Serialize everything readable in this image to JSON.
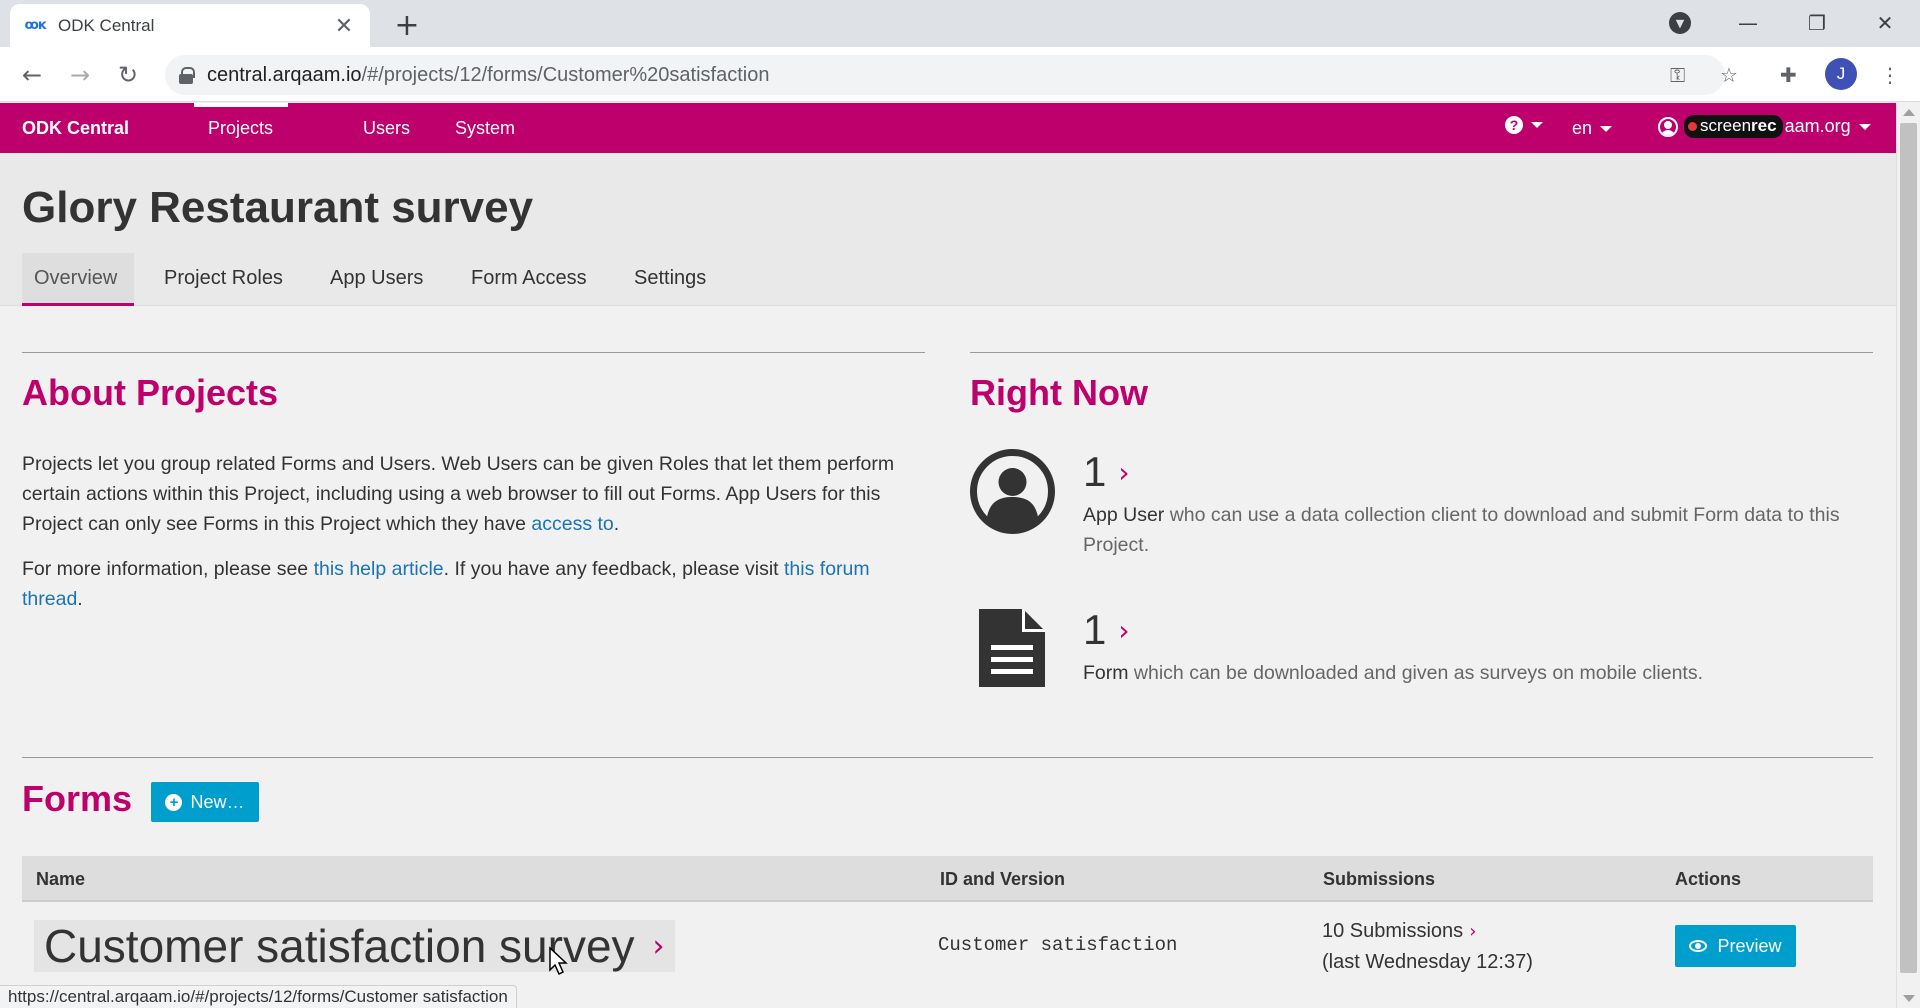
{
  "browser": {
    "tab_title": "ODK Central",
    "tab_close": "✕",
    "new_tab": "+",
    "url_host": "central.arqaam.io",
    "url_path": "/#/projects/12/forms/Customer%20satisfaction",
    "profile_initial": "J",
    "status_url": "https://central.arqaam.io/#/projects/12/forms/Customer satisfaction"
  },
  "navbar": {
    "brand": "ODK Central",
    "links": [
      "Projects",
      "Users",
      "System"
    ],
    "language": "en",
    "user_email_visible": "aam.org",
    "overlay": {
      "screen": "screen",
      "rec": "rec"
    }
  },
  "project": {
    "title": "Glory Restaurant survey",
    "tabs": [
      "Overview",
      "Project Roles",
      "App Users",
      "Form Access",
      "Settings"
    ]
  },
  "about": {
    "title": "About Projects",
    "p1_text": "Projects let you group related Forms and Users. Web Users can be given Roles that let them perform certain actions within this Project, including using a web browser to fill out Forms. App Users for this Project can only see Forms in this Project which they have ",
    "p1_link": "access to",
    "p1_end": ".",
    "p2_text": "For more information, please see ",
    "p2_link1": "this help article",
    "p2_mid": ". If you have any feedback, please visit ",
    "p2_link2": "this forum thread",
    "p2_end": "."
  },
  "right_now": {
    "title": "Right Now",
    "app_users": {
      "count": "1",
      "label": "App User",
      "desc": " who can use a data collection client to download and submit Form data to this Project."
    },
    "forms": {
      "count": "1",
      "label": "Form",
      "desc": " which can be downloaded and given as surveys on mobile clients."
    }
  },
  "forms": {
    "title": "Forms",
    "new_button": "New…",
    "columns": [
      "Name",
      "ID and Version",
      "Submissions",
      "Actions"
    ],
    "rows": [
      {
        "name": "Customer satisfaction survey",
        "id": "Customer satisfaction",
        "submissions": "10 Submissions",
        "last": "(last Wednesday 12:37)",
        "action": "Preview"
      }
    ]
  },
  "colors": {
    "brand": "#bd006b",
    "button": "#009ecc",
    "link": "#1a73b4"
  }
}
